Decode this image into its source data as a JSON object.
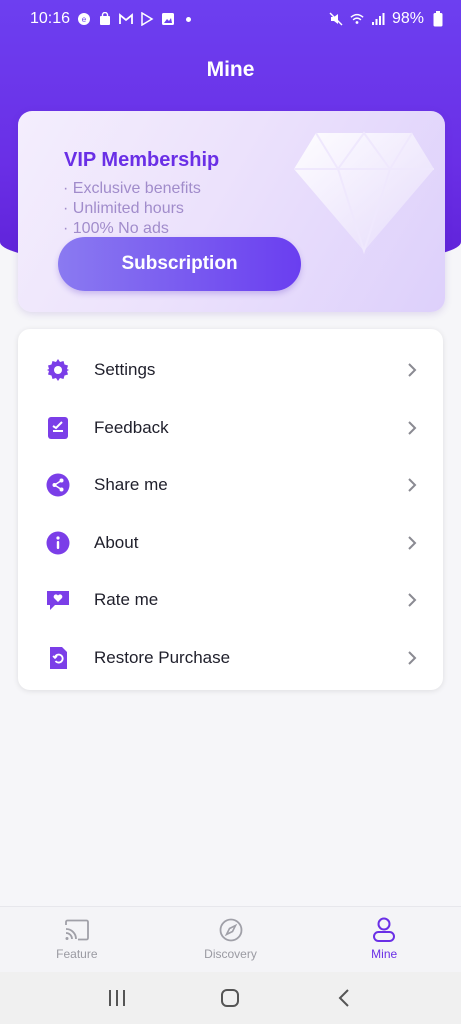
{
  "status_bar": {
    "time": "10:16",
    "battery": "98%",
    "icons_left": [
      "fahrzeug-app-icon",
      "shopping-bag-icon",
      "gmail-icon",
      "play-store-icon",
      "gallery-icon",
      "notification-dot-icon"
    ],
    "icons_right": [
      "mute-icon",
      "wifi-icon",
      "signal-icon",
      "battery-icon"
    ]
  },
  "header": {
    "title": "Mine"
  },
  "vip": {
    "title": "VIP Membership",
    "benefits": [
      "· Exclusive benefits",
      "· Unlimited hours",
      "· 100% No ads"
    ],
    "button_label": "Subscription"
  },
  "menu": {
    "items": [
      {
        "label": "Settings",
        "icon": "gear-icon"
      },
      {
        "label": "Feedback",
        "icon": "feedback-icon"
      },
      {
        "label": "Share me",
        "icon": "share-icon"
      },
      {
        "label": "About",
        "icon": "info-icon"
      },
      {
        "label": "Rate me",
        "icon": "heart-message-icon"
      },
      {
        "label": "Restore Purchase",
        "icon": "restore-icon"
      }
    ]
  },
  "bottom_nav": {
    "tabs": [
      {
        "label": "Feature",
        "icon": "cast-icon",
        "active": false
      },
      {
        "label": "Discovery",
        "icon": "compass-icon",
        "active": false
      },
      {
        "label": "Mine",
        "icon": "person-icon",
        "active": true
      }
    ]
  },
  "colors": {
    "accent": "#6a2fe6",
    "header_bg": "#6d3ff0",
    "icon_purple": "#7b3ee8",
    "inactive": "#9a9aa2"
  }
}
